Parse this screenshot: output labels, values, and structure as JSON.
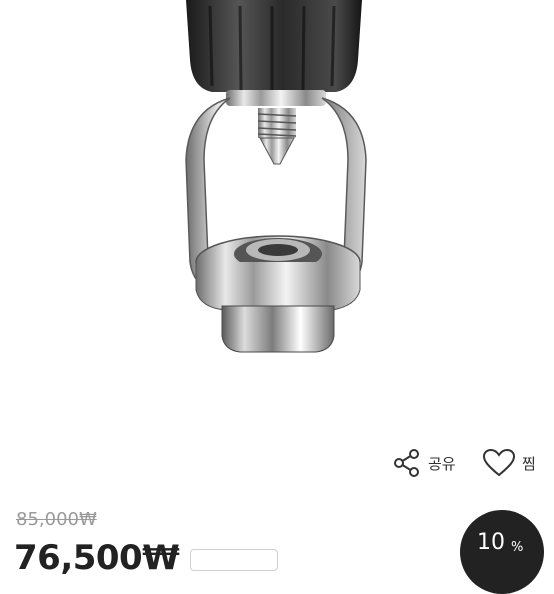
{
  "product_image": {
    "alt": "",
    "icon": "regulator-swivel-adapter-photo"
  },
  "actions": {
    "share": {
      "label": "공유",
      "icon": "share-icon"
    },
    "like": {
      "label": "찜",
      "icon": "heart-outline-icon"
    }
  },
  "price": {
    "original": "85,000₩",
    "sale": "76,500₩"
  },
  "discount": {
    "value": "10",
    "unit": "%"
  },
  "colors": {
    "badge_bg": "#222222",
    "strike_text": "#9a9a9a",
    "price_text": "#222222"
  }
}
